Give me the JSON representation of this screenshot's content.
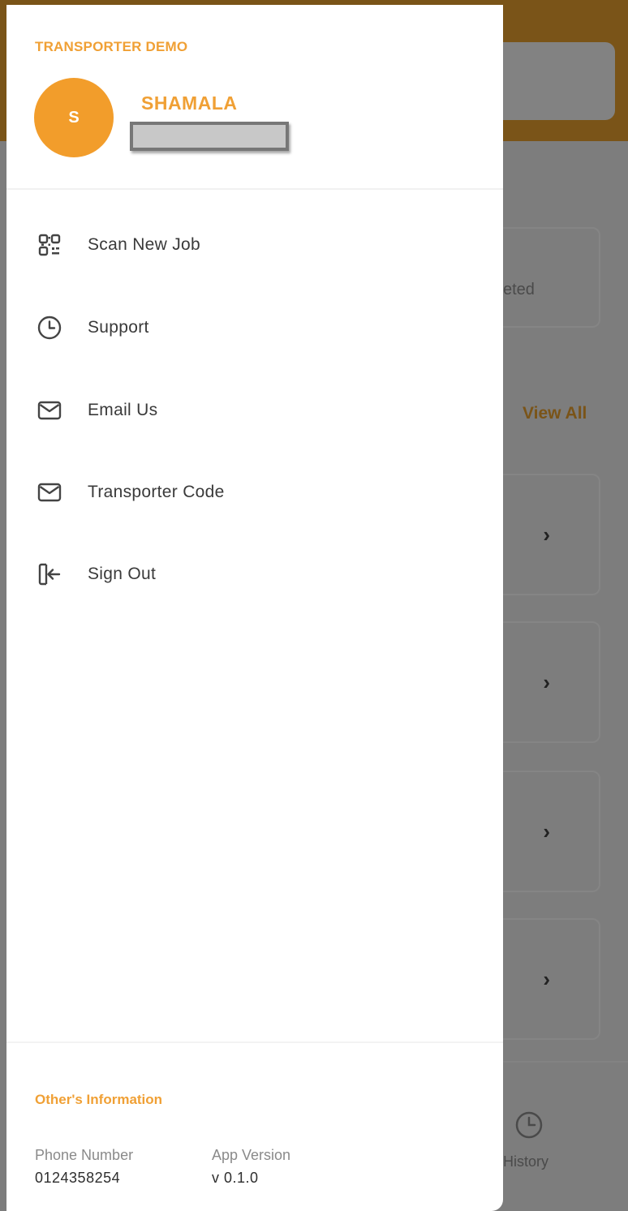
{
  "background": {
    "stat_label": "eted",
    "view_all": "View All",
    "card_chevron": "›",
    "history_label": "History"
  },
  "drawer": {
    "company": "TRANSPORTER DEMO",
    "avatar_letter": "S",
    "user_name": "SHAMALA",
    "menu": [
      {
        "label": "Scan New Job",
        "icon": "qr-code-icon"
      },
      {
        "label": "Support",
        "icon": "clock-icon"
      },
      {
        "label": "Email Us",
        "icon": "mail-icon"
      },
      {
        "label": "Transporter Code",
        "icon": "mail-icon"
      },
      {
        "label": "Sign Out",
        "icon": "sign-out-icon"
      }
    ],
    "info": {
      "title": "Other's Information",
      "phone_label": "Phone Number",
      "phone_value": "0124358254",
      "version_label": "App Version",
      "version_value": "v 0.1.0"
    }
  },
  "colors": {
    "accent": "#f0a035",
    "avatar": "#f29d2b",
    "overlay": "#7d7d7d",
    "header_dimmed": "#7a5418"
  }
}
